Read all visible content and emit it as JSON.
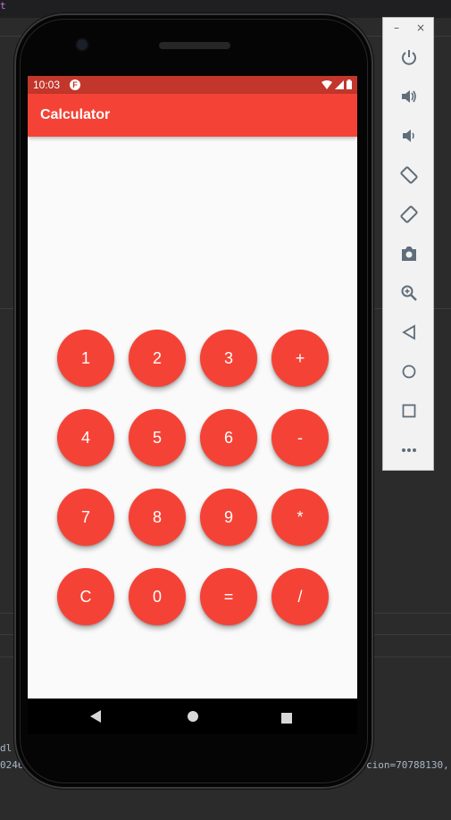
{
  "ide": {
    "top_fragment": "t",
    "log_line_1": "dl",
    "log_line_2": "0246",
    "log_line_3": "cion=70788130,"
  },
  "status_bar": {
    "time": "10:03",
    "notification_glyph": "F"
  },
  "app_bar": {
    "title": "Calculator"
  },
  "keypad": {
    "keys": [
      "1",
      "2",
      "3",
      "+",
      "4",
      "5",
      "6",
      "-",
      "7",
      "8",
      "9",
      "*",
      "C",
      "0",
      "=",
      "/"
    ]
  },
  "emulator_toolbar": {
    "minimize": "–",
    "close": "×",
    "buttons": [
      "power-icon",
      "volume-up-icon",
      "volume-down-icon",
      "rotate-left-icon",
      "rotate-right-icon",
      "camera-icon",
      "zoom-icon",
      "back-icon",
      "home-icon",
      "overview-icon",
      "more-icon"
    ]
  },
  "colors": {
    "primary": "#f44336",
    "status_bar": "#c2362b",
    "background": "#fafafa"
  }
}
